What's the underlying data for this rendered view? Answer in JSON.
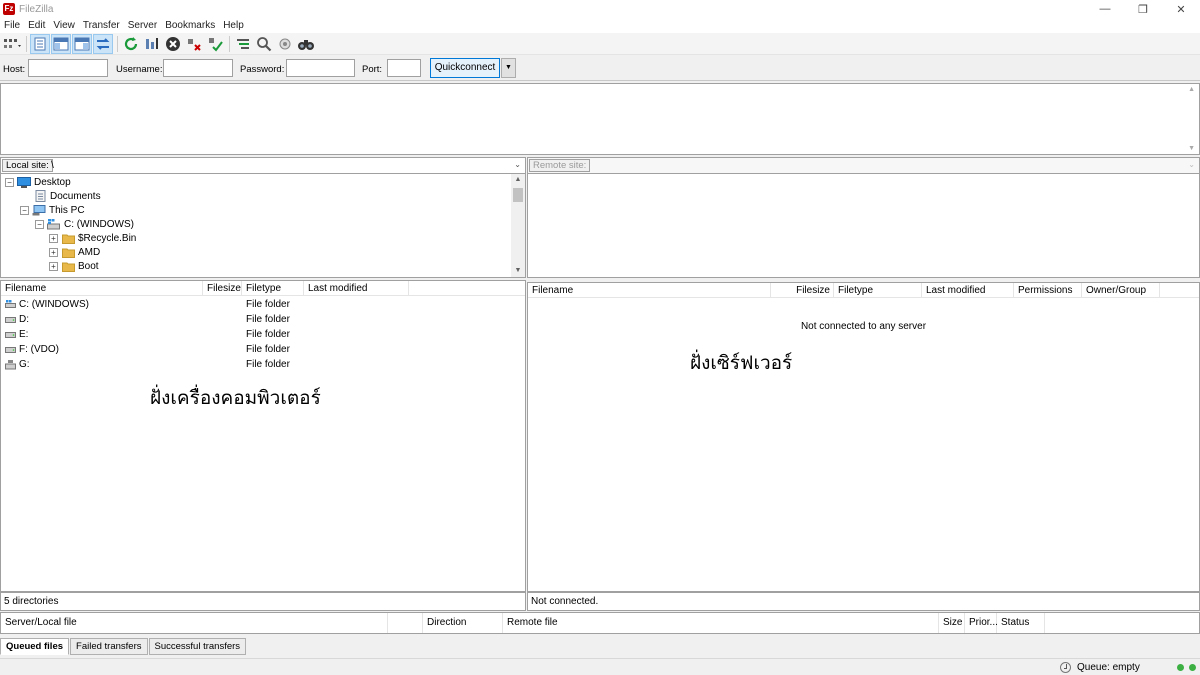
{
  "window": {
    "title": "FileZilla",
    "logo_text": "Fz"
  },
  "window_controls": {
    "minimize": "—",
    "maximize": "❐",
    "close": "✕"
  },
  "menu": [
    "File",
    "Edit",
    "View",
    "Transfer",
    "Server",
    "Bookmarks",
    "Help"
  ],
  "quickconnect": {
    "host_label": "Host:",
    "username_label": "Username:",
    "password_label": "Password:",
    "port_label": "Port:",
    "host_value": "",
    "username_value": "",
    "password_value": "",
    "port_value": "",
    "button_label": "Quickconnect",
    "dropdown_arrow": "▼"
  },
  "local": {
    "site_label": "Local site:",
    "path": "\\",
    "tree": [
      {
        "label": "Desktop"
      },
      {
        "label": "Documents"
      },
      {
        "label": "This PC"
      },
      {
        "label": "C: (WINDOWS)"
      },
      {
        "label": "$Recycle.Bin"
      },
      {
        "label": "AMD"
      },
      {
        "label": "Boot"
      }
    ],
    "columns": [
      "Filename",
      "Filesize",
      "Filetype",
      "Last modified"
    ],
    "files": [
      {
        "name": "C: (WINDOWS)",
        "type": "File folder"
      },
      {
        "name": "D:",
        "type": "File folder"
      },
      {
        "name": "E:",
        "type": "File folder"
      },
      {
        "name": "F: (VDO)",
        "type": "File folder"
      },
      {
        "name": "G:",
        "type": "File folder"
      }
    ],
    "status": "5 directories"
  },
  "remote": {
    "site_label": "Remote site:",
    "columns": [
      "Filename",
      "Filesize",
      "Filetype",
      "Last modified",
      "Permissions",
      "Owner/Group"
    ],
    "empty_message": "Not connected to any server",
    "status": "Not connected."
  },
  "annotations": {
    "local": "ฝั่งเครื่องคอมพิวเตอร์",
    "remote": "ฝั่งเซิร์ฟเวอร์"
  },
  "queue": {
    "columns": [
      "Server/Local file",
      "Direction",
      "Remote file",
      "Size",
      "Prior...",
      "Status"
    ],
    "tabs": [
      "Queued files",
      "Failed transfers",
      "Successful transfers"
    ],
    "status": "Queue: empty"
  },
  "colors": {
    "accent": "#0078d7",
    "folder": "#e8b94a",
    "led_green": "#3cb043",
    "led_red": "#6b6b6b"
  }
}
